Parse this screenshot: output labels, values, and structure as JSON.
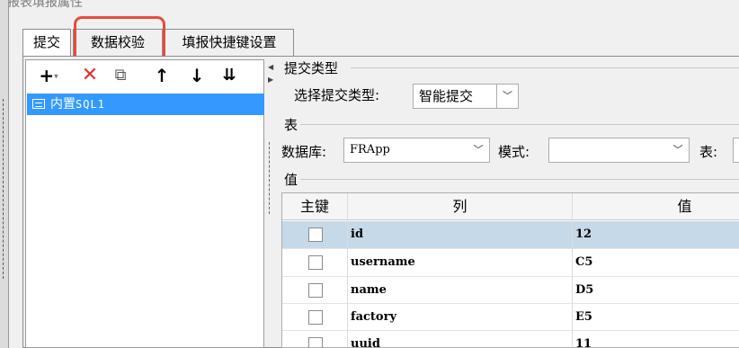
{
  "dialog": {
    "title": "报表填报属性"
  },
  "tabs": [
    {
      "label": "提交"
    },
    {
      "label": "数据校验"
    },
    {
      "label": "填报快捷键设置"
    }
  ],
  "toolbar": {
    "add": "+",
    "add_caret": "▾",
    "delete": "✕",
    "copy": "⧉",
    "up": "↑",
    "down": "↓",
    "sort": "⇊"
  },
  "tree": {
    "items": [
      {
        "prefix": "内置",
        "name": "SQL1"
      }
    ]
  },
  "submit_section": {
    "title": "提交类型",
    "type_label": "选择提交类型:",
    "type_value": "智能提交",
    "table_section": "表",
    "db_label": "数据库:",
    "db_value": "FRApp",
    "schema_label": "模式:",
    "schema_value": "",
    "table_label": "表:",
    "value_section": "值"
  },
  "grid": {
    "headers": {
      "key": "主键",
      "column": "列",
      "value": "值"
    },
    "rows": [
      {
        "column": "id",
        "value": "12",
        "selected": true
      },
      {
        "column": "username",
        "value": "C5",
        "selected": false
      },
      {
        "column": "name",
        "value": "D5",
        "selected": false
      },
      {
        "column": "factory",
        "value": "E5",
        "selected": false
      },
      {
        "column": "uuid",
        "value": "11",
        "selected": false
      }
    ]
  },
  "icons": {
    "dropdown": "chevron-down-icon",
    "tree_item": "sql-dataset-icon"
  },
  "colors": {
    "highlight": "#e74c3c",
    "selection": "#3399ff",
    "row_selected": "#c5d9e8",
    "delete": "#e03131"
  }
}
